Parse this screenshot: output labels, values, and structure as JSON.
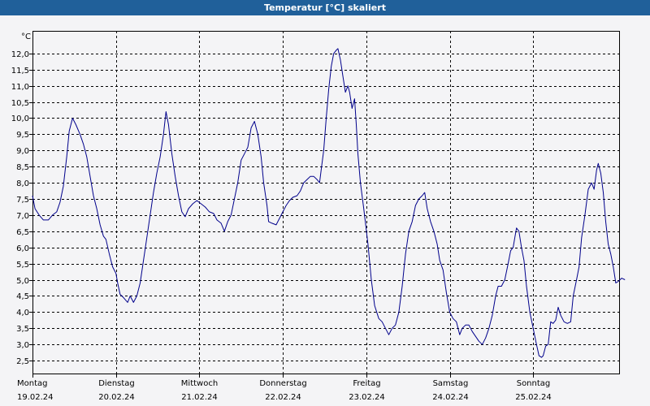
{
  "window": {
    "title": "Temperatur [°C] skaliert"
  },
  "chart_data": {
    "type": "line",
    "title": "Temperatur [°C] skaliert",
    "ylabel": "°C",
    "ylim": [
      2.1,
      12.7
    ],
    "yticks": [
      2.5,
      3.0,
      3.5,
      4.0,
      4.5,
      5.0,
      5.5,
      6.0,
      6.5,
      7.0,
      7.5,
      8.0,
      8.5,
      9.0,
      9.5,
      10.0,
      10.5,
      11.0,
      11.5,
      12.0
    ],
    "ytick_labels": [
      "2,5",
      "3,0",
      "3,5",
      "4,0",
      "4,5",
      "5,0",
      "5,5",
      "6,0",
      "6,5",
      "7,0",
      "7,5",
      "8,0",
      "8,5",
      "9,0",
      "9,5",
      "10,0",
      "10,5",
      "11,0",
      "11,5",
      "12,0"
    ],
    "xlim": [
      0,
      7
    ],
    "xticks": [
      {
        "x": 0,
        "day": "Montag",
        "date": "19.02.24"
      },
      {
        "x": 1,
        "day": "Dienstag",
        "date": "20.02.24"
      },
      {
        "x": 2,
        "day": "Mittwoch",
        "date": "21.02.24"
      },
      {
        "x": 3,
        "day": "Donnerstag",
        "date": "22.02.24"
      },
      {
        "x": 4,
        "day": "Freitag",
        "date": "23.02.24"
      },
      {
        "x": 5,
        "day": "Samstag",
        "date": "24.02.24"
      },
      {
        "x": 6,
        "day": "Sonntag",
        "date": "25.02.24"
      }
    ],
    "grid": true,
    "series": [
      {
        "color": "#00008b",
        "points": [
          [
            0.0,
            7.6
          ],
          [
            0.03,
            7.2
          ],
          [
            0.08,
            7.0
          ],
          [
            0.13,
            6.85
          ],
          [
            0.19,
            6.85
          ],
          [
            0.24,
            7.0
          ],
          [
            0.29,
            7.1
          ],
          [
            0.33,
            7.4
          ],
          [
            0.37,
            7.9
          ],
          [
            0.41,
            8.8
          ],
          [
            0.44,
            9.6
          ],
          [
            0.48,
            10.0
          ],
          [
            0.52,
            9.8
          ],
          [
            0.57,
            9.5
          ],
          [
            0.61,
            9.2
          ],
          [
            0.65,
            8.8
          ],
          [
            0.69,
            8.2
          ],
          [
            0.73,
            7.6
          ],
          [
            0.77,
            7.2
          ],
          [
            0.81,
            6.7
          ],
          [
            0.85,
            6.35
          ],
          [
            0.88,
            6.25
          ],
          [
            0.92,
            5.8
          ],
          [
            0.96,
            5.4
          ],
          [
            1.0,
            5.2
          ],
          [
            1.02,
            4.9
          ],
          [
            1.05,
            4.55
          ],
          [
            1.09,
            4.45
          ],
          [
            1.14,
            4.3
          ],
          [
            1.17,
            4.5
          ],
          [
            1.21,
            4.3
          ],
          [
            1.25,
            4.5
          ],
          [
            1.29,
            4.9
          ],
          [
            1.33,
            5.6
          ],
          [
            1.37,
            6.3
          ],
          [
            1.41,
            7.0
          ],
          [
            1.45,
            7.7
          ],
          [
            1.49,
            8.3
          ],
          [
            1.53,
            8.8
          ],
          [
            1.57,
            9.5
          ],
          [
            1.6,
            10.2
          ],
          [
            1.63,
            9.8
          ],
          [
            1.67,
            8.9
          ],
          [
            1.71,
            8.2
          ],
          [
            1.75,
            7.6
          ],
          [
            1.79,
            7.1
          ],
          [
            1.83,
            6.95
          ],
          [
            1.87,
            7.2
          ],
          [
            1.92,
            7.35
          ],
          [
            1.97,
            7.45
          ],
          [
            2.02,
            7.35
          ],
          [
            2.07,
            7.25
          ],
          [
            2.12,
            7.1
          ],
          [
            2.17,
            7.05
          ],
          [
            2.21,
            6.85
          ],
          [
            2.26,
            6.75
          ],
          [
            2.3,
            6.5
          ],
          [
            2.34,
            6.8
          ],
          [
            2.38,
            7.0
          ],
          [
            2.42,
            7.5
          ],
          [
            2.46,
            8.0
          ],
          [
            2.5,
            8.7
          ],
          [
            2.54,
            8.9
          ],
          [
            2.58,
            9.1
          ],
          [
            2.62,
            9.7
          ],
          [
            2.66,
            9.9
          ],
          [
            2.7,
            9.5
          ],
          [
            2.74,
            8.8
          ],
          [
            2.77,
            8.0
          ],
          [
            2.81,
            7.3
          ],
          [
            2.83,
            6.8
          ],
          [
            2.87,
            6.75
          ],
          [
            2.92,
            6.7
          ],
          [
            2.96,
            6.9
          ],
          [
            3.0,
            7.1
          ],
          [
            3.04,
            7.3
          ],
          [
            3.08,
            7.45
          ],
          [
            3.12,
            7.55
          ],
          [
            3.17,
            7.6
          ],
          [
            3.21,
            7.75
          ],
          [
            3.25,
            8.0
          ],
          [
            3.29,
            8.1
          ],
          [
            3.33,
            8.2
          ],
          [
            3.37,
            8.2
          ],
          [
            3.41,
            8.1
          ],
          [
            3.44,
            8.0
          ],
          [
            3.46,
            8.4
          ],
          [
            3.49,
            9.0
          ],
          [
            3.52,
            10.0
          ],
          [
            3.55,
            10.9
          ],
          [
            3.58,
            11.6
          ],
          [
            3.61,
            12.0
          ],
          [
            3.64,
            12.1
          ],
          [
            3.66,
            12.15
          ],
          [
            3.69,
            11.8
          ],
          [
            3.72,
            11.3
          ],
          [
            3.75,
            10.8
          ],
          [
            3.78,
            11.0
          ],
          [
            3.8,
            10.8
          ],
          [
            3.83,
            10.3
          ],
          [
            3.86,
            10.6
          ],
          [
            3.88,
            9.8
          ],
          [
            3.9,
            8.9
          ],
          [
            3.93,
            8.0
          ],
          [
            3.97,
            7.2
          ],
          [
            4.02,
            6.1
          ],
          [
            4.06,
            5.0
          ],
          [
            4.1,
            4.2
          ],
          [
            4.15,
            3.8
          ],
          [
            4.19,
            3.7
          ],
          [
            4.23,
            3.5
          ],
          [
            4.27,
            3.3
          ],
          [
            4.31,
            3.5
          ],
          [
            4.35,
            3.6
          ],
          [
            4.39,
            4.0
          ],
          [
            4.43,
            4.8
          ],
          [
            4.47,
            5.8
          ],
          [
            4.51,
            6.5
          ],
          [
            4.55,
            6.8
          ],
          [
            4.59,
            7.3
          ],
          [
            4.63,
            7.5
          ],
          [
            4.67,
            7.6
          ],
          [
            4.7,
            7.7
          ],
          [
            4.73,
            7.2
          ],
          [
            4.77,
            6.8
          ],
          [
            4.81,
            6.5
          ],
          [
            4.85,
            6.1
          ],
          [
            4.88,
            5.6
          ],
          [
            4.92,
            5.3
          ],
          [
            4.96,
            4.6
          ],
          [
            5.0,
            4.0
          ],
          [
            5.04,
            3.8
          ],
          [
            5.08,
            3.7
          ],
          [
            5.12,
            3.3
          ],
          [
            5.15,
            3.5
          ],
          [
            5.19,
            3.6
          ],
          [
            5.23,
            3.6
          ],
          [
            5.27,
            3.4
          ],
          [
            5.31,
            3.25
          ],
          [
            5.35,
            3.1
          ],
          [
            5.39,
            3.0
          ],
          [
            5.43,
            3.2
          ],
          [
            5.47,
            3.5
          ],
          [
            5.51,
            3.9
          ],
          [
            5.55,
            4.5
          ],
          [
            5.58,
            4.8
          ],
          [
            5.62,
            4.8
          ],
          [
            5.66,
            5.0
          ],
          [
            5.7,
            5.5
          ],
          [
            5.73,
            5.9
          ],
          [
            5.76,
            6.0
          ],
          [
            5.78,
            6.3
          ],
          [
            5.8,
            6.6
          ],
          [
            5.83,
            6.5
          ],
          [
            5.86,
            6.0
          ],
          [
            5.89,
            5.6
          ],
          [
            5.92,
            4.8
          ],
          [
            5.96,
            4.0
          ],
          [
            6.0,
            3.5
          ],
          [
            6.04,
            3.0
          ],
          [
            6.07,
            2.65
          ],
          [
            6.1,
            2.6
          ],
          [
            6.12,
            2.65
          ],
          [
            6.15,
            2.95
          ],
          [
            6.18,
            3.0
          ],
          [
            6.21,
            3.7
          ],
          [
            6.24,
            3.65
          ],
          [
            6.27,
            3.75
          ],
          [
            6.3,
            4.15
          ],
          [
            6.33,
            3.9
          ],
          [
            6.37,
            3.7
          ],
          [
            6.41,
            3.65
          ],
          [
            6.45,
            3.7
          ],
          [
            6.48,
            4.5
          ],
          [
            6.52,
            5.0
          ],
          [
            6.55,
            5.4
          ],
          [
            6.58,
            6.3
          ],
          [
            6.62,
            7.0
          ],
          [
            6.66,
            7.8
          ],
          [
            6.7,
            8.0
          ],
          [
            6.73,
            7.8
          ],
          [
            6.76,
            8.4
          ],
          [
            6.78,
            8.6
          ],
          [
            6.81,
            8.3
          ],
          [
            6.84,
            7.7
          ],
          [
            6.87,
            6.8
          ],
          [
            6.9,
            6.1
          ],
          [
            6.93,
            5.8
          ],
          [
            6.96,
            5.4
          ],
          [
            6.99,
            4.9
          ],
          [
            7.02,
            4.95
          ],
          [
            7.06,
            5.05
          ],
          [
            7.1,
            5.0
          ]
        ]
      }
    ]
  }
}
